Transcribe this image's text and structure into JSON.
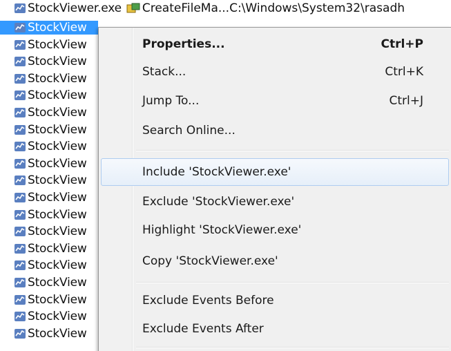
{
  "process_list": {
    "top_row": {
      "process": "StockViewer.exe",
      "operation": "CreateFileMa...",
      "path": "C:\\Windows\\System32\\rasadh"
    },
    "process_label": "StockView",
    "rows_count_visible": 19
  },
  "context_menu": {
    "items": [
      {
        "label": "Properties...",
        "shortcut": "Ctrl+P",
        "default": true
      },
      {
        "label": "Stack...",
        "shortcut": "Ctrl+K"
      },
      {
        "label": "Jump To...",
        "shortcut": "Ctrl+J"
      },
      {
        "label": "Search Online...",
        "shortcut": ""
      },
      {
        "label": "Include 'StockViewer.exe'",
        "shortcut": "",
        "hovered": true
      },
      {
        "label": "Exclude 'StockViewer.exe'",
        "shortcut": ""
      },
      {
        "label": "Highlight 'StockViewer.exe'",
        "shortcut": ""
      },
      {
        "label": "Copy 'StockViewer.exe'",
        "shortcut": ""
      },
      {
        "label": "Exclude Events Before",
        "shortcut": ""
      },
      {
        "label": "Exclude Events After",
        "shortcut": ""
      }
    ]
  },
  "colors": {
    "selection": "#3399ff",
    "menu_background": "#f0f0f0",
    "hover_border": "#aeccf0"
  },
  "icons": {
    "process": "stock-viewer-process-icon",
    "operation": "create-file-mapping-icon"
  }
}
